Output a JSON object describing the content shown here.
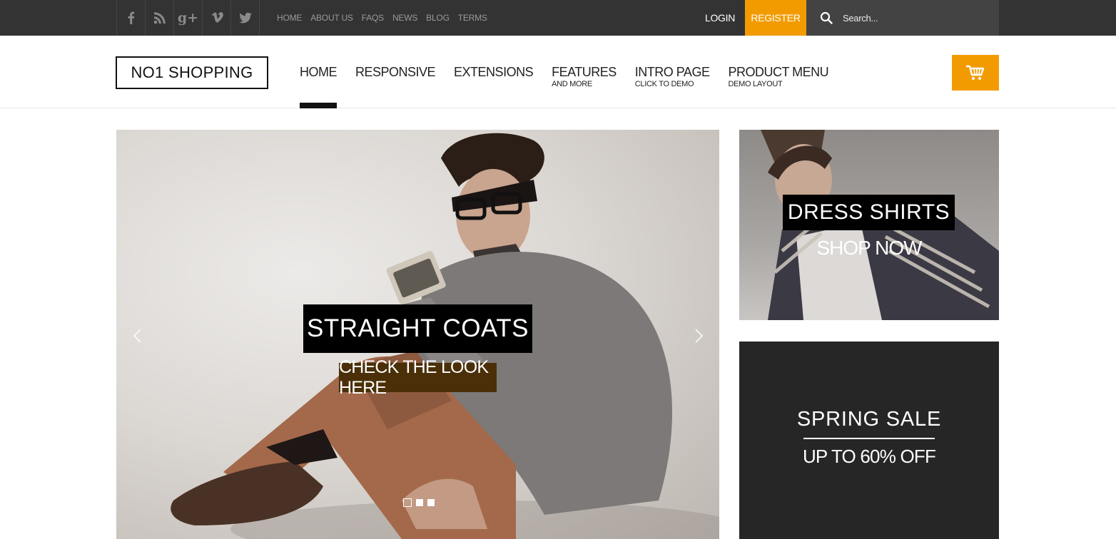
{
  "topbar": {
    "social": [
      {
        "name": "facebook-icon"
      },
      {
        "name": "rss-icon"
      },
      {
        "name": "google-plus-icon",
        "text": "g+"
      },
      {
        "name": "vimeo-icon",
        "text": "v"
      },
      {
        "name": "twitter-icon"
      }
    ],
    "links": [
      "HOME",
      "ABOUT US",
      "FAQS",
      "NEWS",
      "BLOG",
      "TERMS"
    ],
    "login_label": "LOGIN",
    "register_label": "REGISTER",
    "search_placeholder": "Search...",
    "accent_color": "#f29b00"
  },
  "header": {
    "logo": "NO1 SHOPPING",
    "nav": [
      {
        "label": "HOME",
        "sub": "",
        "active": true
      },
      {
        "label": "RESPONSIVE",
        "sub": ""
      },
      {
        "label": "EXTENSIONS",
        "sub": ""
      },
      {
        "label": "FEATURES",
        "sub": "AND MORE"
      },
      {
        "label": "INTRO PAGE",
        "sub": "CLICK TO DEMO"
      },
      {
        "label": "PRODUCT MENU",
        "sub": "DEMO LAYOUT"
      }
    ],
    "cart_icon": "shopping-cart-icon"
  },
  "hero": {
    "title": "STRAIGHT COATS",
    "button": "CHECK THE LOOK HERE",
    "slide_count": 3,
    "active_slide": 1
  },
  "promos": {
    "dress_shirts": {
      "title": "DRESS SHIRTS",
      "subtitle": "SHOP NOW"
    },
    "spring_sale": {
      "title": "SPRING SALE",
      "subtitle": "UP TO 60% OFF"
    }
  }
}
